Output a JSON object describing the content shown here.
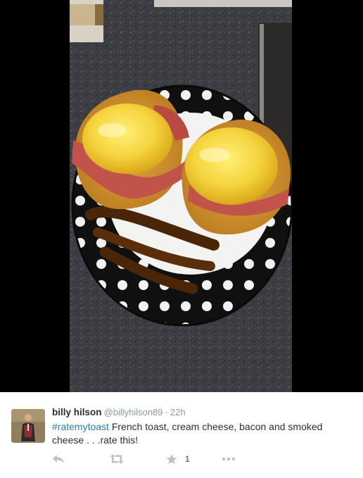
{
  "tweet": {
    "fullname": "billy hilson",
    "username": "@billyhilson89",
    "separator": "·",
    "time": "22h",
    "hashtag": "#ratemytoast",
    "text": " French toast, cream cheese, bacon and smoked cheese . . .rate this!"
  },
  "actions": {
    "reply_icon": "reply-arrow-icon",
    "retweet_icon": "retweet-icon",
    "favorite_icon": "star-icon",
    "favorite_count": "1",
    "more_icon": "more-dots-icon"
  },
  "colors": {
    "link": "#2b7bb9",
    "muted": "#8899a6",
    "action_icon": "#b7c2cb",
    "text": "#292f33"
  }
}
